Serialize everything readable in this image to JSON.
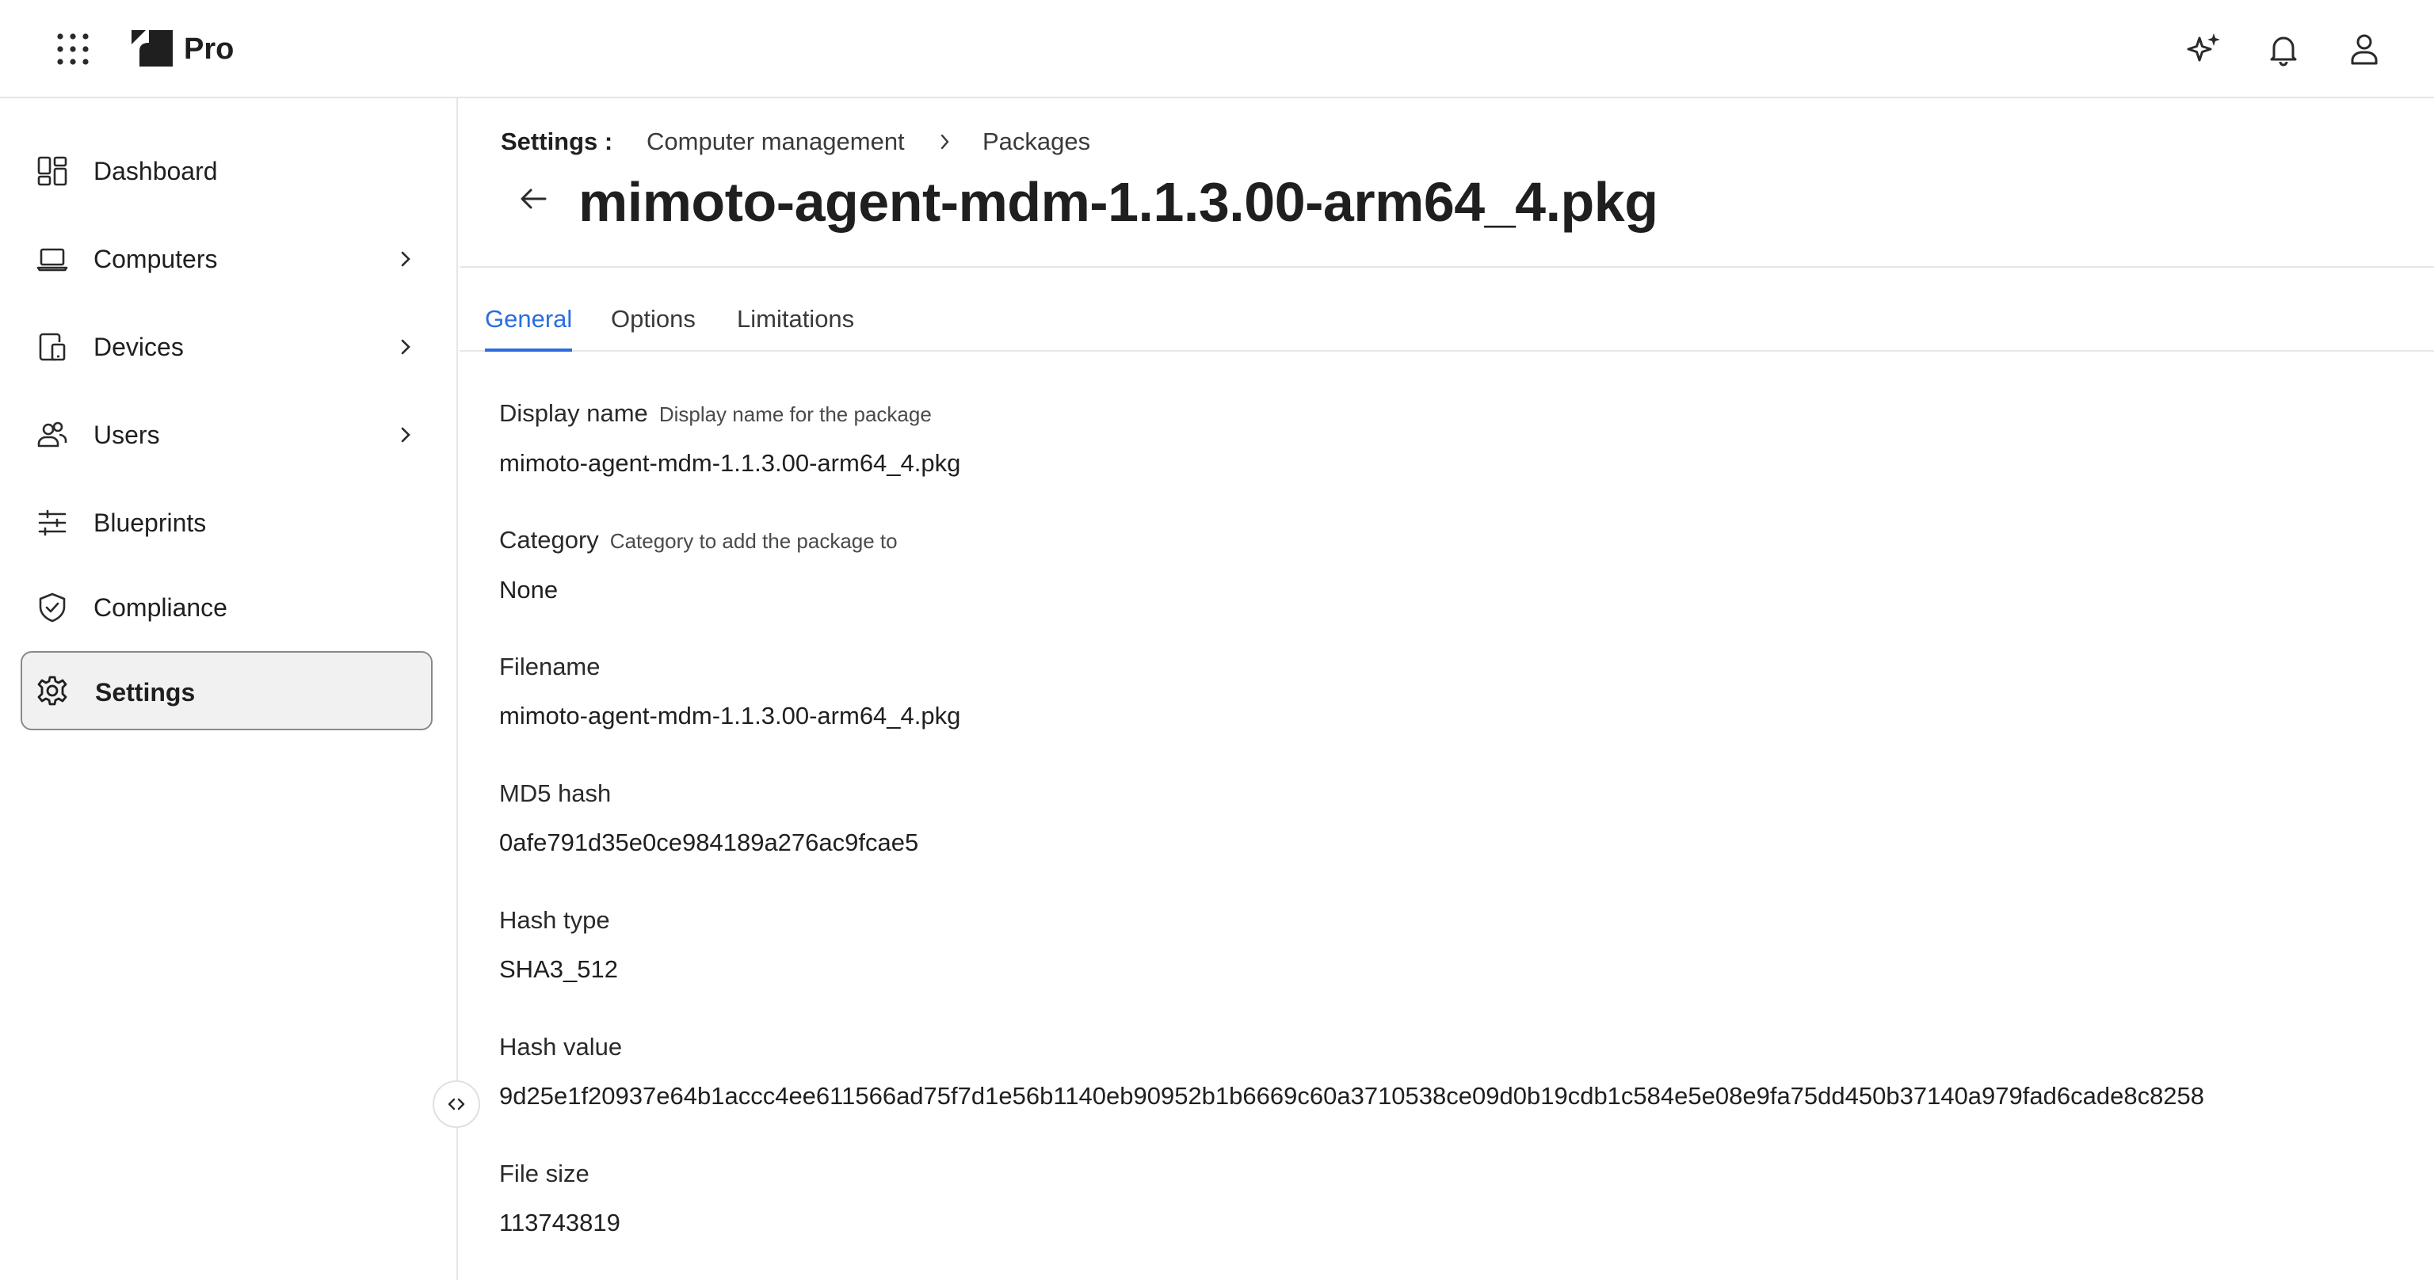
{
  "topbar": {
    "brand": "Pro",
    "icons": [
      "apps-grid-icon",
      "ai-sparkle-icon",
      "bell-icon",
      "user-icon"
    ]
  },
  "sidebar": {
    "items": [
      {
        "label": "Dashboard",
        "icon": "dashboard-icon",
        "has_chevron": false
      },
      {
        "label": "Computers",
        "icon": "laptop-icon",
        "has_chevron": true
      },
      {
        "label": "Devices",
        "icon": "devices-icon",
        "has_chevron": true
      },
      {
        "label": "Users",
        "icon": "users-icon",
        "has_chevron": true
      },
      {
        "label": "Blueprints",
        "icon": "sliders-icon",
        "has_chevron": false
      },
      {
        "label": "Compliance",
        "icon": "shield-check-icon",
        "has_chevron": false
      },
      {
        "label": "Settings",
        "icon": "gear-icon",
        "has_chevron": false,
        "active": true
      }
    ]
  },
  "breadcrumb": {
    "root": "Settings :",
    "items": [
      "Computer management",
      "Packages"
    ]
  },
  "page": {
    "title": "mimoto-agent-mdm-1.1.3.00-arm64_4.pkg"
  },
  "tabs": [
    {
      "label": "General",
      "active": true
    },
    {
      "label": "Options",
      "active": false
    },
    {
      "label": "Limitations",
      "active": false
    }
  ],
  "fields": {
    "display_name": {
      "label": "Display name",
      "hint": "Display name for the package",
      "value": "mimoto-agent-mdm-1.1.3.00-arm64_4.pkg"
    },
    "category": {
      "label": "Category",
      "hint": "Category to add the package to",
      "value": "None"
    },
    "filename": {
      "label": "Filename",
      "value": "mimoto-agent-mdm-1.1.3.00-arm64_4.pkg"
    },
    "md5_hash": {
      "label": "MD5 hash",
      "value": "0afe791d35e0ce984189a276ac9fcae5"
    },
    "hash_type": {
      "label": "Hash type",
      "value": "SHA3_512"
    },
    "hash_value": {
      "label": "Hash value",
      "value": "9d25e1f20937e64b1accc4ee611566ad75f7d1e56b1140eb90952b1b6669c60a3710538ce09d0b19cdb1c584e5e08e9fa75dd450b37140a979fad6cade8c8258"
    },
    "file_size": {
      "label": "File size",
      "value": "113743819"
    }
  },
  "colors": {
    "accent": "#2b6de0",
    "text": "#1f1f1f",
    "border": "#e6e6e6",
    "active_nav_bg": "#f1f1f1"
  }
}
